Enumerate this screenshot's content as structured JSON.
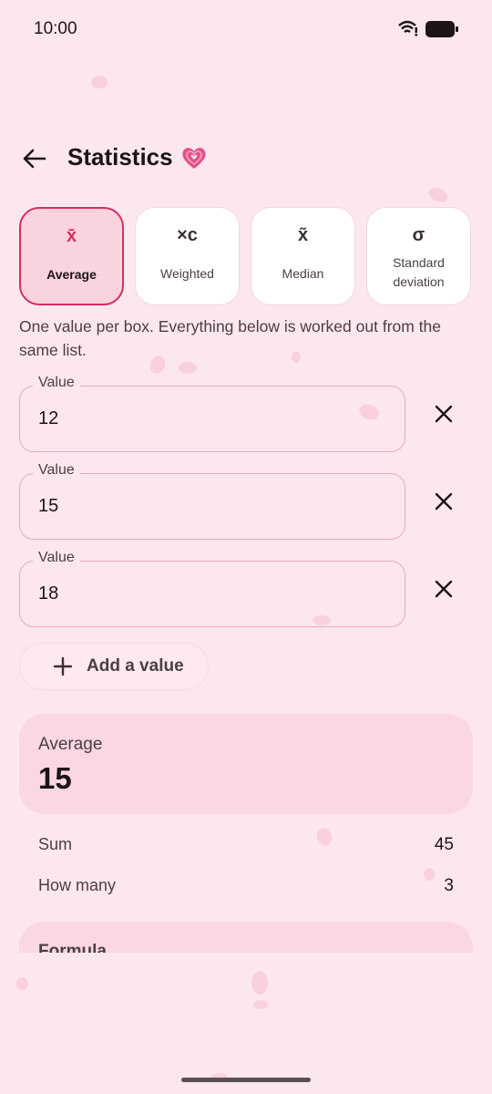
{
  "status_bar": {
    "time": "10:00"
  },
  "header": {
    "title": "Statistics"
  },
  "tabs": [
    {
      "symbol": "x̄",
      "label": "Average",
      "active": true
    },
    {
      "symbol": "×c",
      "label": "Weighted",
      "active": false
    },
    {
      "symbol": "x̃",
      "label": "Median",
      "active": false
    },
    {
      "symbol": "σ",
      "label_line1": "Standard",
      "label_line2": "deviation",
      "active": false
    }
  ],
  "hint": "One value per box. Everything below is worked out from the same list.",
  "values": [
    {
      "label": "Value",
      "value": "12"
    },
    {
      "label": "Value",
      "value": "15"
    },
    {
      "label": "Value",
      "value": "18"
    }
  ],
  "add_button": {
    "label": "Add a value"
  },
  "result": {
    "label": "Average",
    "value": "15"
  },
  "stats": [
    {
      "label": "Sum",
      "value": "45"
    },
    {
      "label": "How many",
      "value": "3"
    }
  ],
  "formula": {
    "label": "Formula"
  },
  "colors": {
    "accent": "#d2305f",
    "background": "#fde7ee",
    "card": "#fad7e1"
  },
  "icons": {
    "back": "arrow-left-icon",
    "heart": "sparkling-heart-icon",
    "remove": "close-icon",
    "add": "plus-icon"
  }
}
